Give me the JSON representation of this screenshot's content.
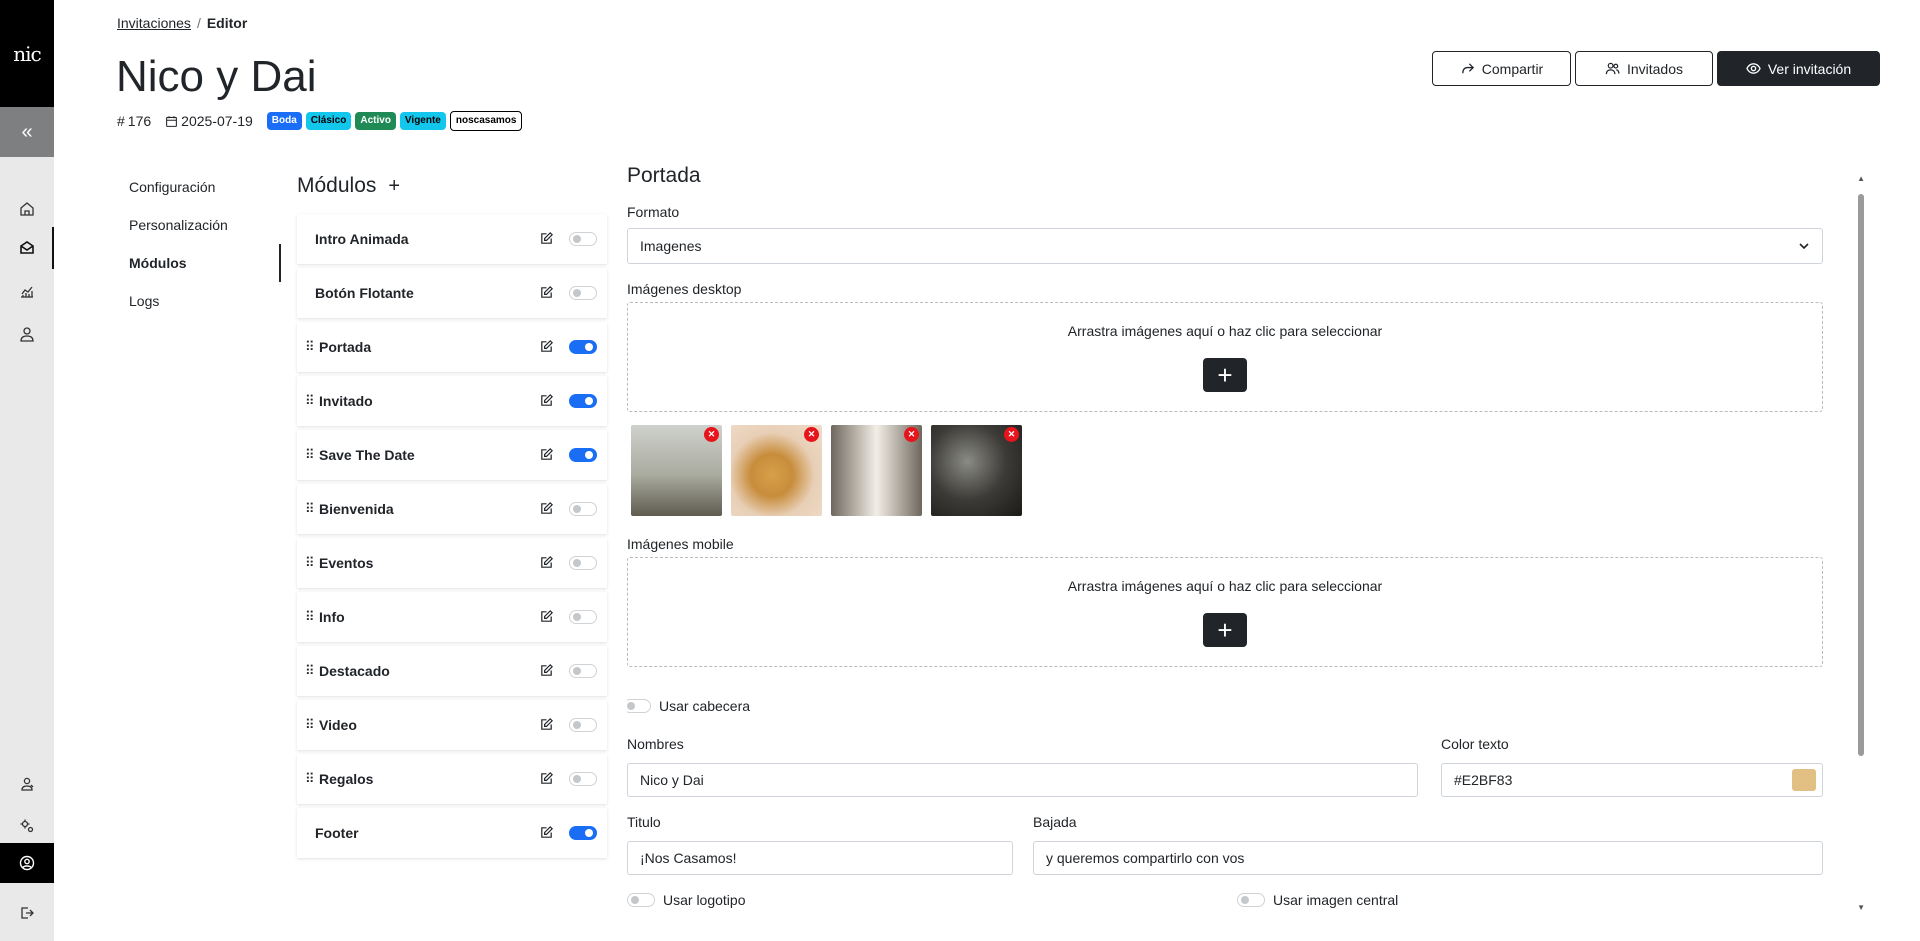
{
  "app": {
    "logo_text": "nic"
  },
  "rail": {
    "items": [
      "home-icon",
      "mail-icon",
      "chart-icon",
      "user-icon"
    ],
    "bottom_items": [
      "users-admin-icon",
      "settings-icon",
      "profile-icon",
      "logout-icon"
    ]
  },
  "breadcrumb": {
    "parent": "Invitaciones",
    "separator": "/",
    "current": "Editor"
  },
  "page": {
    "title": "Nico y Dai",
    "id": "176",
    "date": "2025-07-19",
    "badges": [
      "Boda",
      "Clásico",
      "Activo",
      "Vigente",
      "noscasamos"
    ]
  },
  "header_buttons": {
    "share": "Compartir",
    "guests": "Invitados",
    "view": "Ver invitación"
  },
  "settings_nav": [
    "Configuración",
    "Personalización",
    "Módulos",
    "Logs"
  ],
  "modules": {
    "title": "Módulos",
    "add_symbol": "+",
    "items": [
      {
        "name": "Intro Animada",
        "draggable": false,
        "enabled": false
      },
      {
        "name": "Botón Flotante",
        "draggable": false,
        "enabled": false
      },
      {
        "name": "Portada",
        "draggable": true,
        "enabled": true
      },
      {
        "name": "Invitado",
        "draggable": true,
        "enabled": true
      },
      {
        "name": "Save The Date",
        "draggable": true,
        "enabled": true
      },
      {
        "name": "Bienvenida",
        "draggable": true,
        "enabled": false
      },
      {
        "name": "Eventos",
        "draggable": true,
        "enabled": false
      },
      {
        "name": "Info",
        "draggable": true,
        "enabled": false
      },
      {
        "name": "Destacado",
        "draggable": true,
        "enabled": false
      },
      {
        "name": "Video",
        "draggable": true,
        "enabled": false
      },
      {
        "name": "Regalos",
        "draggable": true,
        "enabled": false
      },
      {
        "name": "Footer",
        "draggable": false,
        "enabled": true
      }
    ]
  },
  "form": {
    "title": "Portada",
    "format_label": "Formato",
    "format_value": "Imagenes",
    "desktop_label": "Imágenes desktop",
    "drop_text": "Arrastra imágenes aquí o haz clic para seleccionar",
    "mobile_label": "Imágenes mobile",
    "use_header": "Usar cabecera",
    "names_label": "Nombres",
    "names_value": "Nico y Dai",
    "color_label": "Color texto",
    "color_value": "#E2BF83",
    "title_label": "Titulo",
    "title_value": "¡Nos Casamos!",
    "subtitle_label": "Bajada",
    "subtitle_value": "y queremos compartirlo con vos",
    "use_logo": "Usar logotipo",
    "use_center_image": "Usar imagen central",
    "remove_symbol": "✕",
    "add_symbol": "+"
  }
}
